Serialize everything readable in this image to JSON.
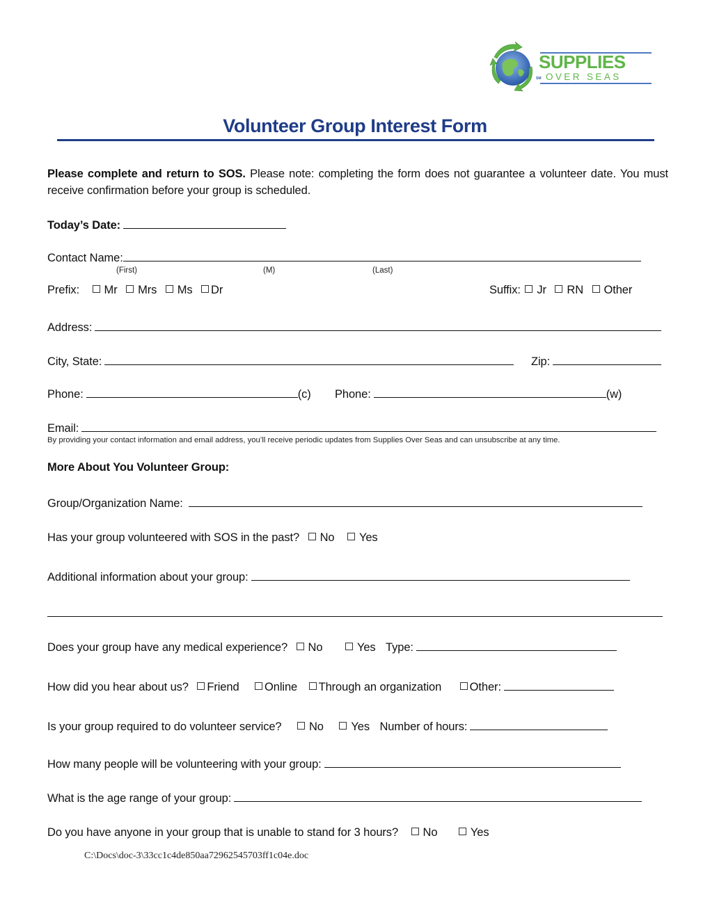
{
  "logo": {
    "name_line1": "SUPPLIES",
    "name_line2": "OVER SEAS",
    "service_mark": "SM",
    "colors": {
      "green": "#5fb548",
      "blue": "#2a5aa8"
    }
  },
  "title": "Volunteer Group Interest Form",
  "intro": {
    "bold_lead": "Please complete and return to SOS.",
    "text": " Please note: completing the form does not guarantee a volunteer date. You must receive confirmation before your group is scheduled."
  },
  "fields": {
    "todays_date": {
      "label": "Today’s Date:",
      "value": ""
    },
    "contact_name": {
      "label": "Contact Name:",
      "value": "",
      "sublabels": [
        "(First)",
        "(M)",
        "(Last)"
      ]
    },
    "prefix": {
      "label": "Prefix:",
      "options": [
        "Mr",
        "Mrs",
        "Ms",
        "Dr"
      ]
    },
    "suffix": {
      "label": "Suffix:",
      "options": [
        "Jr",
        "RN",
        "Other"
      ]
    },
    "address": {
      "label": "Address:",
      "value": ""
    },
    "city_state": {
      "label": "City, State:",
      "value": ""
    },
    "zip": {
      "label": "Zip:",
      "value": ""
    },
    "phone_cell": {
      "label": "Phone:",
      "value": "",
      "suffix": "(c)"
    },
    "phone_work": {
      "label": "Phone:",
      "value": "",
      "suffix": "(w)"
    },
    "email": {
      "label": "Email:",
      "value": ""
    },
    "email_note": "By providing your contact information and email address, you’ll receive periodic updates from Supplies Over Seas and can unsubscribe at any time."
  },
  "group_section": {
    "heading": "More About You Volunteer Group:",
    "org_name": {
      "label": "Group/Organization Name:",
      "value": ""
    },
    "past_volunteer": {
      "label": "Has your group volunteered with SOS in the past?",
      "options": [
        "No",
        "Yes"
      ]
    },
    "additional_info": {
      "label": "Additional information about your group:",
      "value": "",
      "value_line2": ""
    },
    "medical": {
      "label": "Does your group have any medical experience?",
      "options": [
        "No",
        "Yes"
      ],
      "type_label": "Type:",
      "type_value": ""
    },
    "hear_about": {
      "label": "How did you hear about us?",
      "options": [
        "Friend",
        "Online",
        "Through an organization",
        "Other:"
      ],
      "other_value": ""
    },
    "required_service": {
      "label": "Is your group required to do volunteer service?",
      "options": [
        "No",
        "Yes"
      ],
      "hours_label": "Number of hours:",
      "hours_value": ""
    },
    "people_count": {
      "label": "How many people will be volunteering with your group:",
      "value": ""
    },
    "age_range": {
      "label": "What is the age range of your group:",
      "value": ""
    },
    "stand_3_hours": {
      "label": "Do you have anyone in your group that is unable to stand for 3 hours?",
      "options": [
        "No",
        "Yes"
      ]
    }
  },
  "footer": {
    "path": "C:\\Docs\\doc-3\\33cc1c4de850aa72962545703ff1c04e.doc"
  }
}
